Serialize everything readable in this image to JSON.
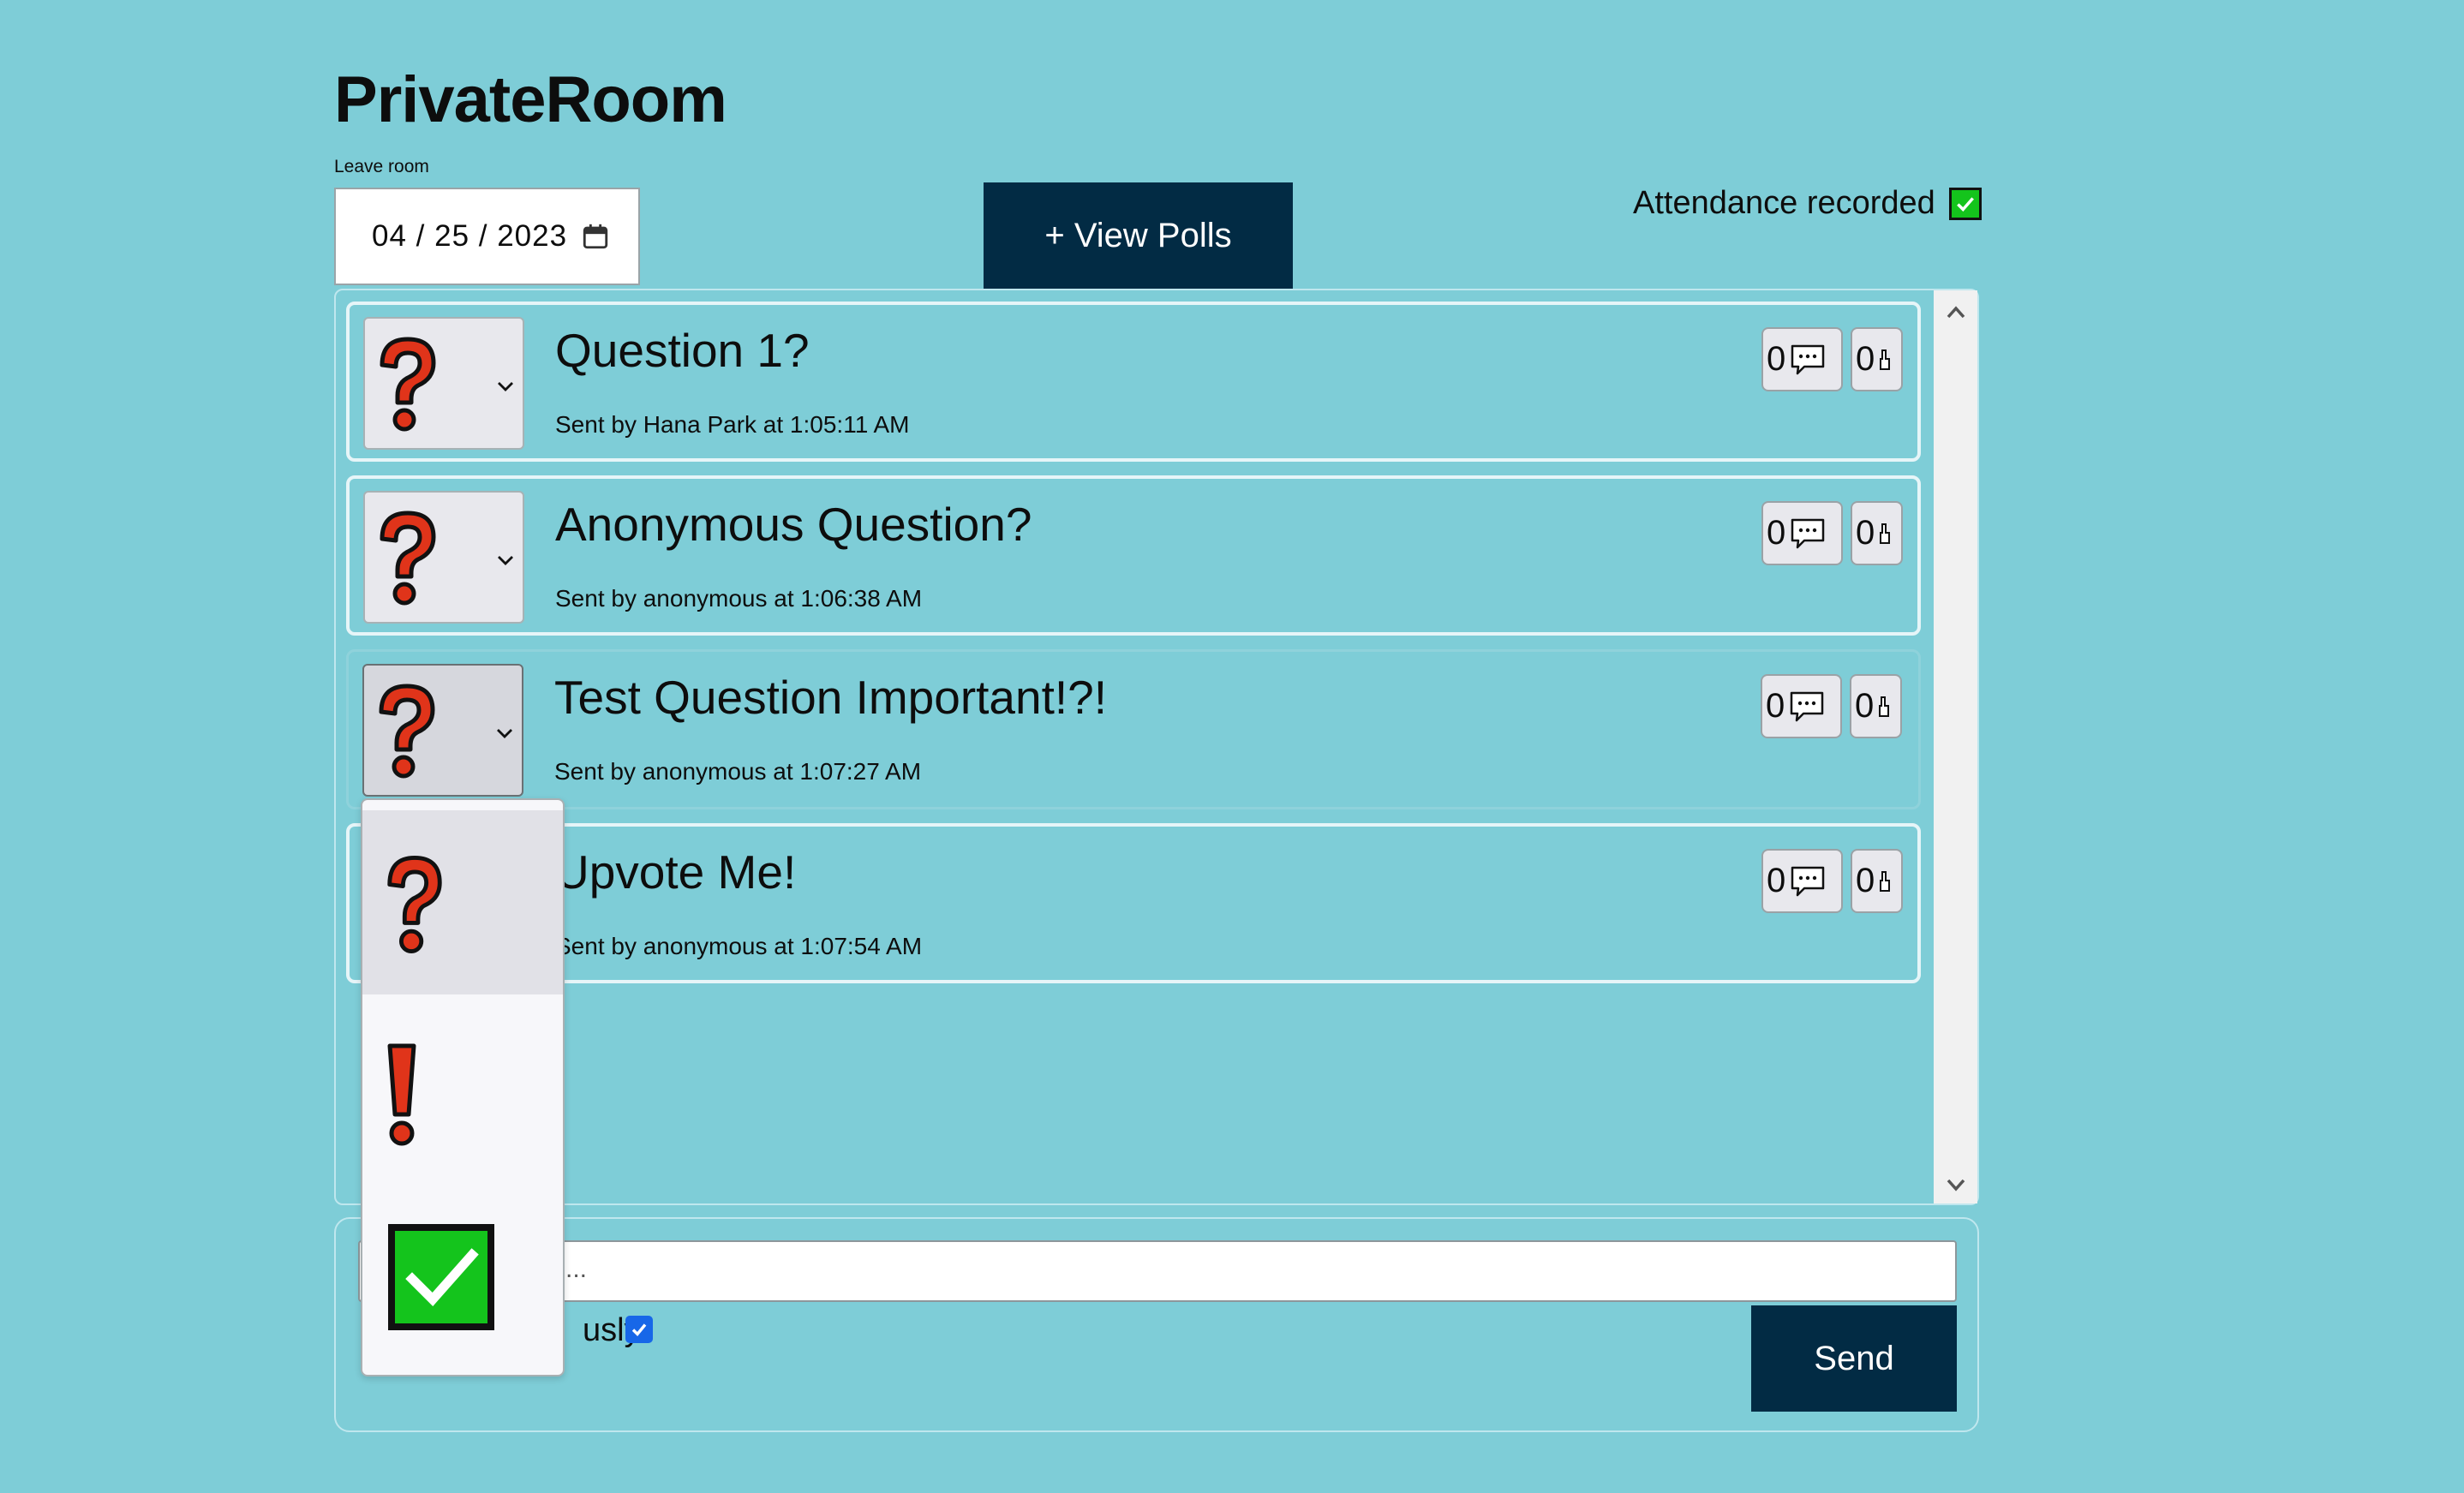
{
  "header": {
    "title": "PrivateRoom",
    "leave_label": "Leave room",
    "date_value": "04 / 25 / 2023",
    "view_polls_label": "+ View Polls",
    "attendance_label": "Attendance recorded",
    "attendance_checked": true
  },
  "questions": [
    {
      "title": "Question 1?",
      "meta": "Sent by Hana Park at 1:05:11 AM",
      "status_icon": "question-mark",
      "comment_count": "0",
      "upvote_count": "0"
    },
    {
      "title": "Anonymous Question?",
      "meta": "Sent by anonymous at 1:06:38 AM",
      "status_icon": "question-mark",
      "comment_count": "0",
      "upvote_count": "0"
    },
    {
      "title": "Test Question Important!?!",
      "meta": "Sent by anonymous at 1:07:27 AM",
      "status_icon": "question-mark",
      "comment_count": "0",
      "upvote_count": "0"
    },
    {
      "title": "Upvote Me!",
      "meta": "Sent by anonymous at 1:07:54 AM",
      "status_icon": "question-mark",
      "comment_count": "0",
      "upvote_count": "0"
    }
  ],
  "status_dropdown": {
    "options": [
      "question-mark",
      "exclamation-mark",
      "green-check"
    ],
    "selected": "question-mark"
  },
  "compose": {
    "input_visible_text": "...",
    "anon_label_visible": "usly",
    "anon_checked": true,
    "send_label": "Send"
  },
  "colors": {
    "background": "#7ecdd7",
    "button_dark": "#022b44",
    "icon_red": "#e0341a",
    "check_green": "#14c41c",
    "checkbox_blue": "#1767e8"
  }
}
